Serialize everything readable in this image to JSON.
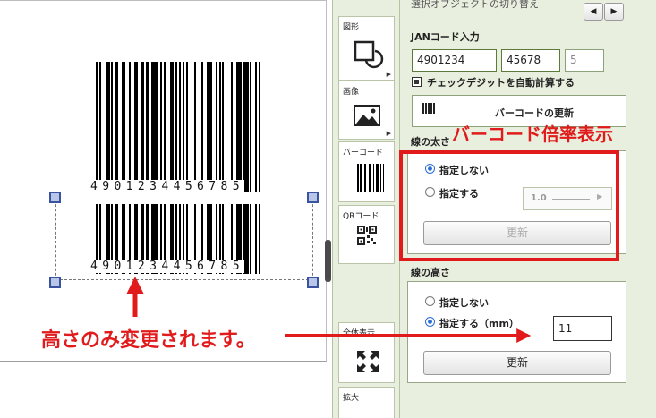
{
  "barcode": {
    "top_digits": "4901234456785",
    "bottom_digits": "4901234456785"
  },
  "tools": [
    {
      "label": "図形",
      "icon": "shape-icon"
    },
    {
      "label": "画像",
      "icon": "image-icon"
    },
    {
      "label": "バーコード",
      "icon": "barcode-icon"
    },
    {
      "label": "QRコード",
      "icon": "qr-code-icon"
    },
    {
      "label": "全体表示",
      "icon": "fit-all-icon"
    },
    {
      "label": "拡大",
      "icon": "zoom-in-icon"
    }
  ],
  "panel": {
    "switch_label": "選択オブジェクトの切り替え",
    "prev_label": "◀",
    "next_label": "▶",
    "jan_label": "JANコード入力",
    "jan_field1": "4901234",
    "jan_field2": "45678",
    "jan_check": "5",
    "checkbox_label": "チェックデジットを自動計算する",
    "update_barcode_label": "バーコードの更新",
    "line_width_label": "線の太さ",
    "width_opt_none": "指定しない",
    "width_opt_set": "指定する",
    "width_value": "1.0",
    "width_update": "更新",
    "line_height_label": "線の高さ",
    "height_opt_none": "指定しない",
    "height_opt_set": "指定する（mm）",
    "height_value": "11",
    "height_update": "更新"
  },
  "annotations": {
    "multiplier": "バーコード倍率表示",
    "height_only": "高さのみ変更されます。"
  },
  "colors": {
    "annotation_red": "#e11b1b",
    "panel_bg": "#e9efdf",
    "radio_on": "#2b6fd6"
  }
}
